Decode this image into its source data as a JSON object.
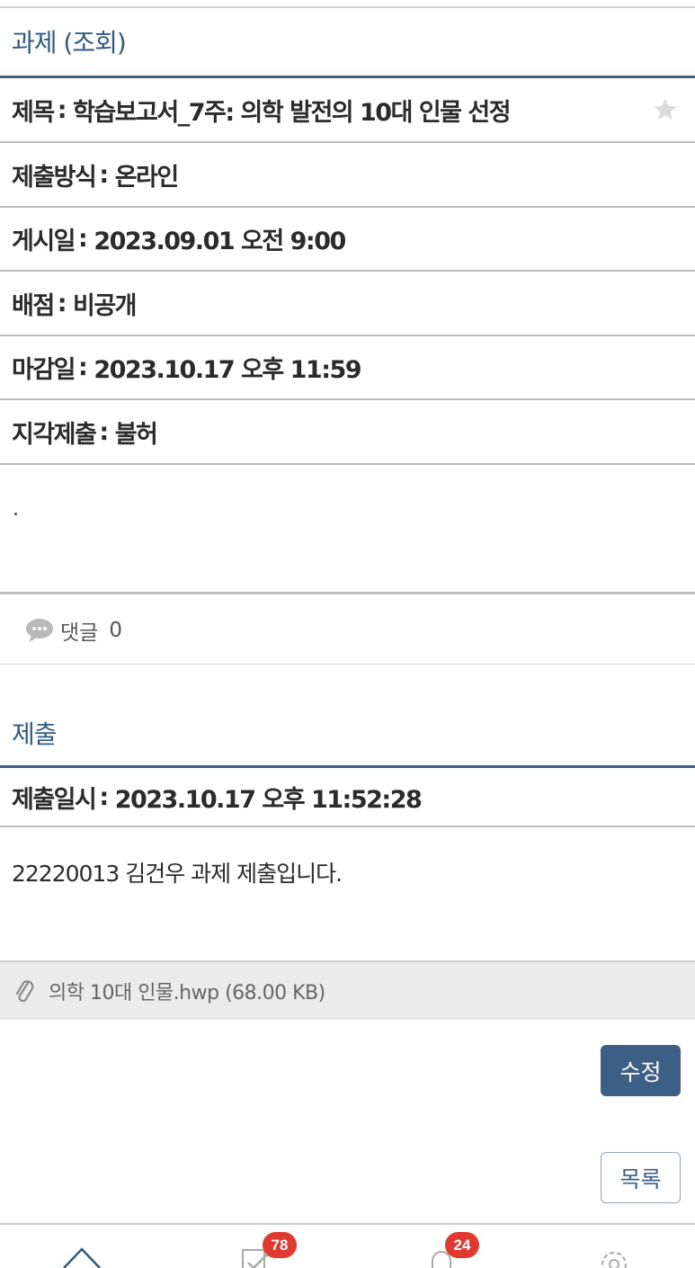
{
  "assignment": {
    "section_title": "과제 (조회)",
    "rows": [
      {
        "label": "제목",
        "value": "학습보고서_7주: 의학 발전의 10대 인물 선정"
      },
      {
        "label": "제출방식",
        "value": "온라인"
      },
      {
        "label": "게시일",
        "value": "2023.09.01 오전 9:00"
      },
      {
        "label": "배점",
        "value": "비공개"
      },
      {
        "label": "마감일",
        "value": "2023.10.17 오후 11:59"
      },
      {
        "label": "지각제출",
        "value": "불허"
      }
    ],
    "separator": ":",
    "body": "."
  },
  "comments": {
    "label": "댓글",
    "count": "0"
  },
  "submission": {
    "section_title": "제출",
    "date_label": "제출일시",
    "date_value": "2023.10.17 오후 11:52:28",
    "text": "22220013 김건우 과제 제출입니다.",
    "attachment": "의학 10대 인물.hwp (68.00 KB)"
  },
  "buttons": {
    "edit": "수정",
    "list": "목록"
  },
  "bottom_nav": {
    "items": [
      {
        "icon": "home-icon"
      },
      {
        "icon": "task-check-icon",
        "badge": "78"
      },
      {
        "icon": "notification-bell-icon",
        "badge": "24"
      },
      {
        "icon": "settings-gear-icon"
      }
    ]
  },
  "colors": {
    "accent": "#3d5f86",
    "title_blue": "#2f5a86",
    "badge_red": "#e03a30",
    "attachment_bg": "#ebebeb"
  }
}
